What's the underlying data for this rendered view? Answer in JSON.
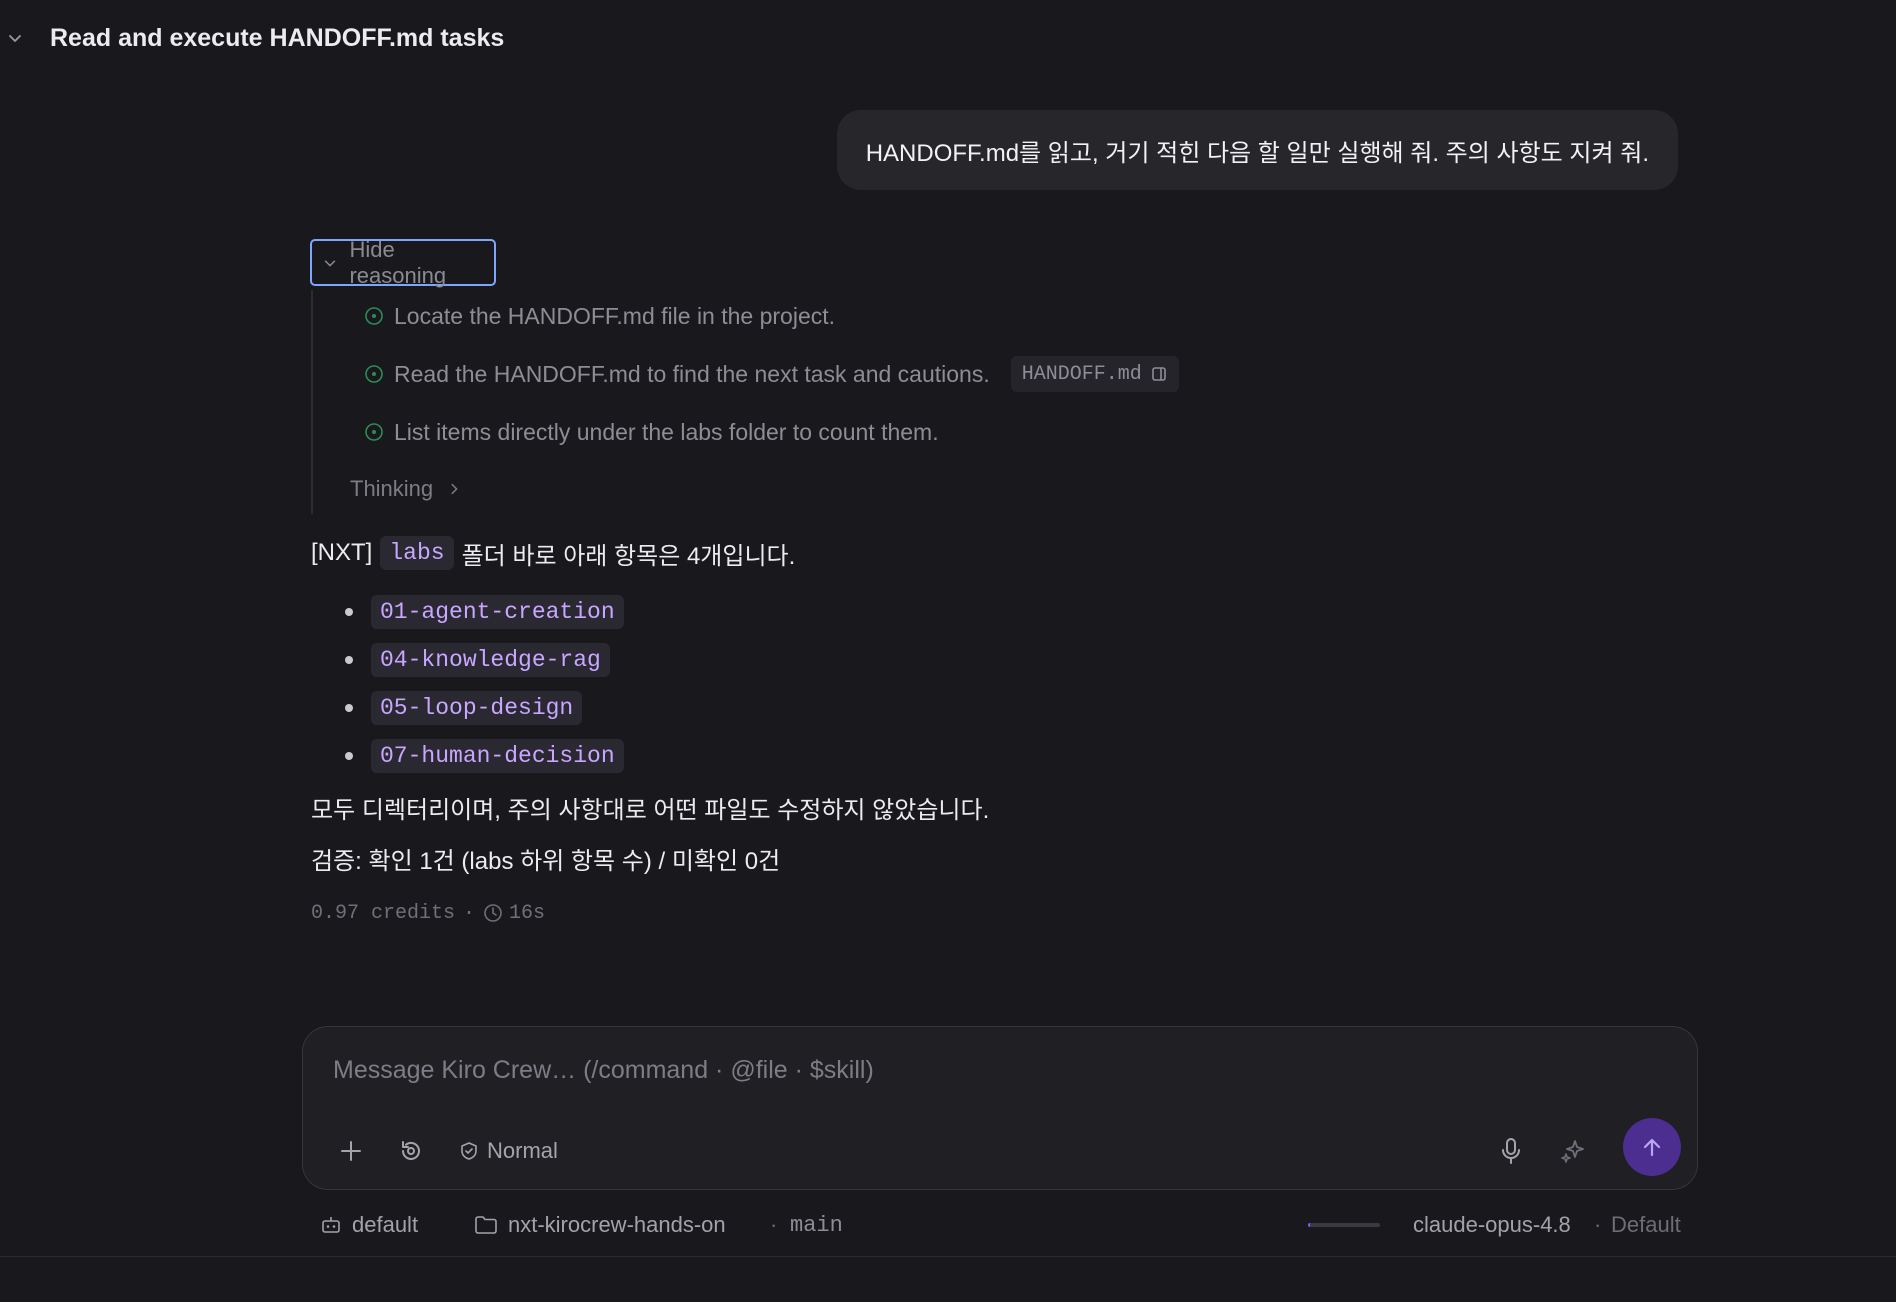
{
  "header": {
    "title": "Read and execute HANDOFF.md tasks",
    "collapse_icon": "chevron-down-icon"
  },
  "user_message": "HANDOFF.md를 읽고, 거기 적힌 다음 할 일만 실행해 줘. 주의 사항도 지켜 줘.",
  "reasoning": {
    "toggle_label": "Hide reasoning",
    "steps": [
      {
        "text": "Locate the HANDOFF.md file in the project."
      },
      {
        "text": "Read the HANDOFF.md to find the next task and cautions.",
        "file_chip": "HANDOFF.md"
      },
      {
        "text": "List items directly under the labs folder to count them."
      }
    ],
    "thinking_label": "Thinking"
  },
  "answer": {
    "prefix": "[NXT]",
    "folder": "labs",
    "suffix": "폴더 바로 아래 항목은 4개입니다.",
    "items": [
      "01-agent-creation",
      "04-knowledge-rag",
      "05-loop-design",
      "07-human-decision"
    ],
    "note": "모두 디렉터리이며, 주의 사항대로 어떤 파일도 수정하지 않았습니다.",
    "verification": "검증: 확인 1건 (labs 하위 항목 수) / 미확인 0건"
  },
  "meta": {
    "credits": "0.97 credits",
    "separator": "·",
    "duration": "16s"
  },
  "composer": {
    "placeholder": "Message Kiro Crew… (/command · @file · $skill)",
    "mode_label": "Normal"
  },
  "statusbar": {
    "agent": "default",
    "project": "nxt-kirocrew-hands-on",
    "branch_sep": "·",
    "branch": "main",
    "context_usage_fraction": 0.03,
    "model": "claude-opus-4.8",
    "model_sep": "·",
    "profile": "Default"
  },
  "colors": {
    "accent": "#7ea6ff",
    "code_text": "#c9a6ff",
    "send_button": "#4b2e8f",
    "step_done": "#2e8b57"
  }
}
